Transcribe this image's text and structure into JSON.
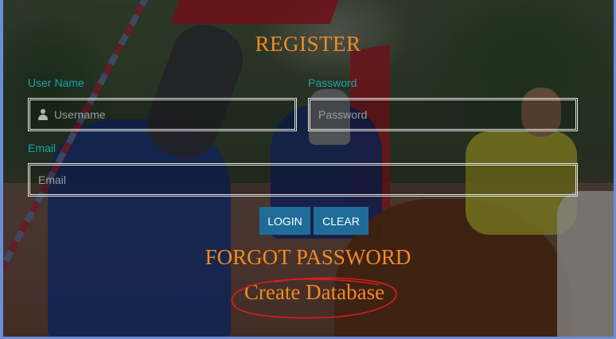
{
  "form": {
    "title": "REGISTER",
    "username": {
      "label": "User Name",
      "placeholder": "Username",
      "value": "",
      "icon": "user-icon"
    },
    "password": {
      "label": "Password",
      "placeholder": "Password",
      "value": ""
    },
    "email": {
      "label": "Email",
      "placeholder": "Email",
      "value": ""
    },
    "buttons": {
      "login": "LOGIN",
      "clear": "CLEAR"
    },
    "forgot_password": "FORGOT PASSWORD",
    "create_database": "Create Database"
  },
  "colors": {
    "accent": "#f28a22",
    "label": "#1fa3a6",
    "button": "#1f6c98",
    "annotation": "#d81e1e"
  }
}
